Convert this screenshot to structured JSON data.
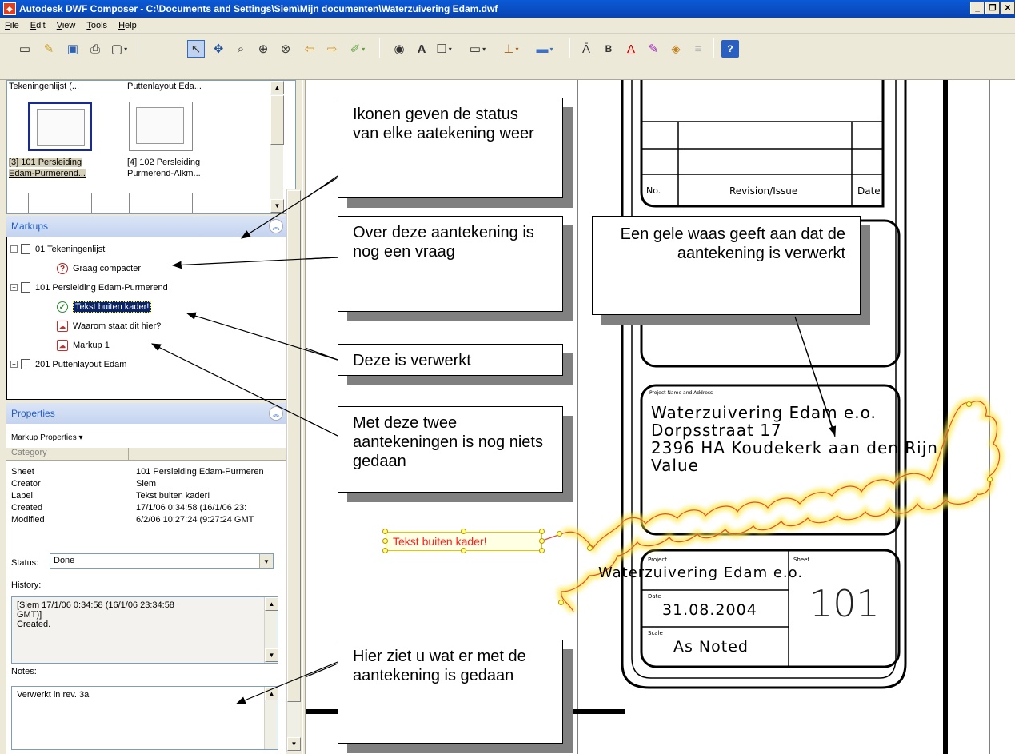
{
  "window": {
    "title": "Autodesk DWF Composer - C:\\Documents and Settings\\Siem\\Mijn documenten\\Waterzuivering Edam.dwf"
  },
  "menu": {
    "items": [
      "File",
      "Edit",
      "View",
      "Tools",
      "Help"
    ]
  },
  "thumbnails": {
    "top_captions": [
      "Tekeningenlijst (...",
      "Puttenlayout Eda..."
    ],
    "items": [
      {
        "line1": "[3] 101 Persleiding",
        "line2": "Edam-Purmerend..."
      },
      {
        "line1": "[4] 102 Persleiding",
        "line2": "Purmerend-Alkm..."
      }
    ]
  },
  "markups": {
    "header": "Markups",
    "tree": [
      {
        "label": "01 Tekeningenlijst"
      },
      {
        "label": "Graag compacter",
        "status": "question"
      },
      {
        "label": "101 Persleiding Edam-Purmerend"
      },
      {
        "label": "Tekst buiten kader!",
        "status": "done"
      },
      {
        "label": "Waarom staat dit hier?",
        "status": "none"
      },
      {
        "label": "Markup 1",
        "status": "none"
      },
      {
        "label": "201 Puttenlayout Edam"
      }
    ]
  },
  "properties": {
    "header": "Properties",
    "subheader": "Markup Properties ▾",
    "category_label": "Category",
    "rows": [
      {
        "key": "Sheet",
        "value": "101 Persleiding Edam-Purmeren"
      },
      {
        "key": "Creator",
        "value": "Siem"
      },
      {
        "key": "Label",
        "value": "Tekst buiten kader!"
      },
      {
        "key": "Created",
        "value": "17/1/06 0:34:58 (16/1/06 23:"
      },
      {
        "key": "Modified",
        "value": "6/2/06 10:27:24 (9:27:24 GMT"
      }
    ],
    "status_label": "Status:",
    "status_value": "Done",
    "history_label": "History:",
    "history_lines": [
      "[Siem 17/1/06 0:34:58 (16/1/06 23:34:58",
      "GMT)]",
      "Created."
    ],
    "notes_label": "Notes:",
    "notes_value": "Verwerkt in rev. 3a"
  },
  "drawing": {
    "revision_no": "No.",
    "revision_issue": "Revision/Issue",
    "revision_date": "Date",
    "project_name_caption": "Project Name and Address",
    "project_name_lines": [
      "Waterzuivering Edam e.o.",
      "Dorpsstraat 17",
      "2396 HA Koudekerk aan den Rijn",
      "Value"
    ],
    "project_caption": "Project",
    "project_value": "Waterzuivering Edam e.o.",
    "sheet_caption": "Sheet",
    "sheet_value": "101",
    "date_caption": "Date",
    "date_value": "31.08.2004",
    "scale_caption": "Scale",
    "scale_value": "As Noted",
    "markup_text": "Tekst buiten kader!"
  },
  "callouts": {
    "icons_status": "Ikonen geven de status van elke aatekening weer",
    "question": "Over deze aantekening is nog een vraag",
    "yellow": "Een gele waas geeft aan dat de aantekening is verwerkt",
    "done": "Deze is verwerkt",
    "nothing": "Met deze twee aantekeningen is nog niets gedaan",
    "history": "Hier ziet u wat er met de aantekening is gedaan"
  },
  "colors": {
    "titlebar": "#0a4fc4",
    "selection": "#0a246a",
    "markup_text": "#ff2020",
    "highlight_glow": "#ffe84a"
  }
}
